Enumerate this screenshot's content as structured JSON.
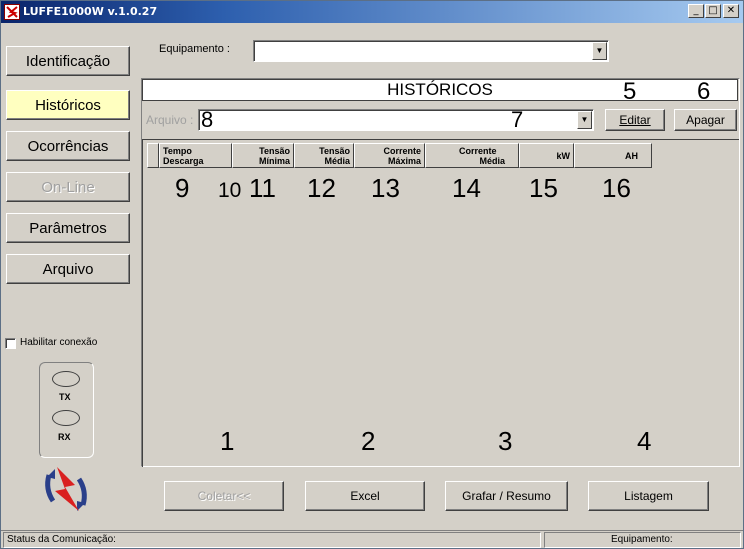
{
  "window": {
    "title": "LUFFE1000W v.1.0.27",
    "controls": {
      "minimize": "_",
      "maximize": "□",
      "close": "✕"
    }
  },
  "nav": {
    "identificacao": "Identificação",
    "historicos": "Históricos",
    "ocorrencias": "Ocorrências",
    "online": "On-Line",
    "parametros": "Parâmetros",
    "arquivo": "Arquivo"
  },
  "equipamento": {
    "label": "Equipamento :",
    "value": ""
  },
  "section_title": "HISTÓRICOS",
  "arquivo_field": {
    "label": "Arquivo :",
    "value": "8"
  },
  "actions": {
    "editar": "Editar",
    "apagar": "Apagar"
  },
  "columns": [
    {
      "line1": "Tempo",
      "line2": "Descarga"
    },
    {
      "line1": "Tensão",
      "line2": "Mínima"
    },
    {
      "line1": "Tensão",
      "line2": "Média"
    },
    {
      "line1": "Corrente",
      "line2": "Máxima"
    },
    {
      "line1": "Corrente",
      "line2": "Média"
    },
    {
      "line1": "kW",
      "line2": ""
    },
    {
      "line1": "AH",
      "line2": ""
    }
  ],
  "annotations": {
    "n1": "1",
    "n2": "2",
    "n3": "3",
    "n4": "4",
    "n5": "5",
    "n6": "6",
    "n7": "7",
    "n9": "9",
    "n10": "10",
    "n11": "11",
    "n12": "12",
    "n13": "13",
    "n14": "14",
    "n15": "15",
    "n16": "16"
  },
  "bottom_buttons": {
    "coletar": "Coletar<<",
    "excel": "Excel",
    "grafar": "Grafar / Resumo",
    "listagem": "Listagem"
  },
  "connection": {
    "habilitar": "Habilitar conexão",
    "tx": "TX",
    "rx": "RX"
  },
  "status": {
    "comunicacao": "Status da Comunicação:",
    "equipamento": "Equipamento:"
  },
  "colors": {
    "active_tab": "#ffffc0",
    "title_start": "#0a246a",
    "title_end": "#a6caf0",
    "logo_red": "#d92020",
    "logo_blue": "#2a3f8a"
  }
}
